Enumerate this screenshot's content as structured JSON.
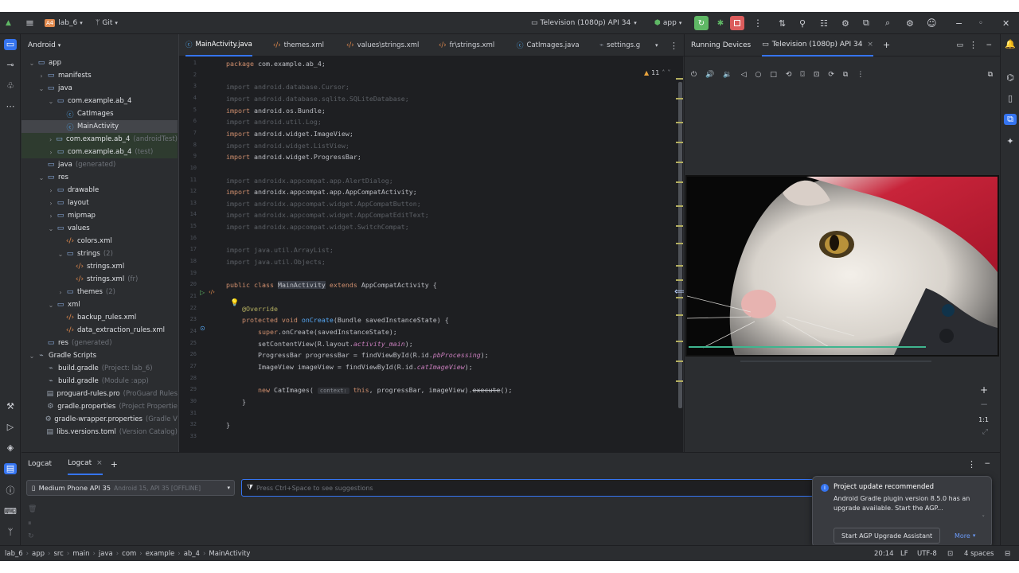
{
  "titlebar": {
    "project_badge": "A4",
    "project": "lab_6",
    "vcs": "Git",
    "device": "Television (1080p) API 34",
    "run_config": "app"
  },
  "project_panel": {
    "title": "Android",
    "tree": [
      {
        "label": "app",
        "sub": "",
        "depth": 0,
        "arrow": "v",
        "icon": "folder",
        "kind": "fold"
      },
      {
        "label": "manifests",
        "sub": "",
        "depth": 1,
        "arrow": ">",
        "icon": "folder",
        "kind": "fold"
      },
      {
        "label": "java",
        "sub": "",
        "depth": 1,
        "arrow": "v",
        "icon": "folder",
        "kind": "fold"
      },
      {
        "label": "com.example.ab_4",
        "sub": "",
        "depth": 2,
        "arrow": "v",
        "icon": "folder",
        "kind": "fold"
      },
      {
        "label": "CatImages",
        "sub": "",
        "depth": 3,
        "arrow": "",
        "icon": "class",
        "kind": "cls"
      },
      {
        "label": "MainActivity",
        "sub": "",
        "depth": 3,
        "arrow": "",
        "icon": "class",
        "kind": "cls",
        "selected": true
      },
      {
        "label": "com.example.ab_4",
        "sub": "(androidTest)",
        "depth": 2,
        "arrow": ">",
        "icon": "folder",
        "kind": "fold",
        "green": true
      },
      {
        "label": "com.example.ab_4",
        "sub": "(test)",
        "depth": 2,
        "arrow": ">",
        "icon": "folder",
        "kind": "fold",
        "green": true
      },
      {
        "label": "java",
        "sub": "(generated)",
        "depth": 1,
        "arrow": "",
        "icon": "folder",
        "kind": "fold"
      },
      {
        "label": "res",
        "sub": "",
        "depth": 1,
        "arrow": "v",
        "icon": "folder",
        "kind": "fold"
      },
      {
        "label": "drawable",
        "sub": "",
        "depth": 2,
        "arrow": ">",
        "icon": "folder",
        "kind": "fold"
      },
      {
        "label": "layout",
        "sub": "",
        "depth": 2,
        "arrow": ">",
        "icon": "folder",
        "kind": "fold"
      },
      {
        "label": "mipmap",
        "sub": "",
        "depth": 2,
        "arrow": ">",
        "icon": "folder",
        "kind": "fold"
      },
      {
        "label": "values",
        "sub": "",
        "depth": 2,
        "arrow": "v",
        "icon": "folder",
        "kind": "fold"
      },
      {
        "label": "colors.xml",
        "sub": "",
        "depth": 3,
        "arrow": "",
        "icon": "xml",
        "kind": "xmlc"
      },
      {
        "label": "strings",
        "sub": "(2)",
        "depth": 3,
        "arrow": "v",
        "icon": "folder",
        "kind": "fold"
      },
      {
        "label": "strings.xml",
        "sub": "",
        "depth": 4,
        "arrow": "",
        "icon": "xml",
        "kind": "xmlc"
      },
      {
        "label": "strings.xml",
        "sub": "(fr)",
        "depth": 4,
        "arrow": "",
        "icon": "xml",
        "kind": "xmlc"
      },
      {
        "label": "themes",
        "sub": "(2)",
        "depth": 3,
        "arrow": ">",
        "icon": "folder",
        "kind": "fold"
      },
      {
        "label": "xml",
        "sub": "",
        "depth": 2,
        "arrow": "v",
        "icon": "folder",
        "kind": "fold"
      },
      {
        "label": "backup_rules.xml",
        "sub": "",
        "depth": 3,
        "arrow": "",
        "icon": "xml",
        "kind": "xmlc"
      },
      {
        "label": "data_extraction_rules.xml",
        "sub": "",
        "depth": 3,
        "arrow": "",
        "icon": "xml",
        "kind": "xmlc"
      },
      {
        "label": "res",
        "sub": "(generated)",
        "depth": 1,
        "arrow": "",
        "icon": "folder",
        "kind": "fold"
      },
      {
        "label": "Gradle Scripts",
        "sub": "",
        "depth": 0,
        "arrow": "v",
        "icon": "gradle",
        "kind": "grd"
      },
      {
        "label": "build.gradle",
        "sub": "(Project: lab_6)",
        "depth": 1,
        "arrow": "",
        "icon": "gradle",
        "kind": "grd"
      },
      {
        "label": "build.gradle",
        "sub": "(Module :app)",
        "depth": 1,
        "arrow": "",
        "icon": "gradle",
        "kind": "grd"
      },
      {
        "label": "proguard-rules.pro",
        "sub": "(ProGuard Rules",
        "depth": 1,
        "arrow": "",
        "icon": "file",
        "kind": "grd"
      },
      {
        "label": "gradle.properties",
        "sub": "(Project Propertie",
        "depth": 1,
        "arrow": "",
        "icon": "gear",
        "kind": "grd"
      },
      {
        "label": "gradle-wrapper.properties",
        "sub": "(Gradle V",
        "depth": 1,
        "arrow": "",
        "icon": "gear",
        "kind": "grd"
      },
      {
        "label": "libs.versions.toml",
        "sub": "(Version Catalog)",
        "depth": 1,
        "arrow": "",
        "icon": "file",
        "kind": "grd"
      }
    ]
  },
  "editor": {
    "tabs": [
      "MainActivity.java",
      "themes.xml",
      "values\\strings.xml",
      "fr\\strings.xml",
      "CatImages.java",
      "settings.g"
    ],
    "warnings": "11",
    "code": [
      {
        "n": "1",
        "html": "<span class='kw'>package</span> <span class='pkg'>com.example.ab_4;</span>"
      },
      {
        "n": "2",
        "html": ""
      },
      {
        "n": "3",
        "html": "<span class='gr'>import android.database.Cursor;</span>"
      },
      {
        "n": "4",
        "html": "<span class='gr'>import android.database.sqlite.SQLiteDatabase;</span>"
      },
      {
        "n": "5",
        "html": "<span class='kw'>import</span> <span class='pkg'>android.os.Bundle;</span>"
      },
      {
        "n": "6",
        "html": "<span class='gr'>import android.util.Log;</span>"
      },
      {
        "n": "7",
        "html": "<span class='kw'>import</span> <span class='pkg'>android.widget.ImageView;</span>"
      },
      {
        "n": "8",
        "html": "<span class='gr'>import android.widget.ListView;</span>"
      },
      {
        "n": "9",
        "html": "<span class='kw'>import</span> <span class='pkg'>android.widget.ProgressBar;</span>"
      },
      {
        "n": "10",
        "html": ""
      },
      {
        "n": "11",
        "html": "<span class='gr'>import androidx.appcompat.app.AlertDialog;</span>"
      },
      {
        "n": "12",
        "html": "<span class='kw'>import</span> <span class='pkg'>androidx.appcompat.app.AppCompatActivity;</span>"
      },
      {
        "n": "13",
        "html": "<span class='gr'>import androidx.appcompat.widget.AppCompatButton;</span>"
      },
      {
        "n": "14",
        "html": "<span class='gr'>import androidx.appcompat.widget.AppCompatEditText;</span>"
      },
      {
        "n": "15",
        "html": "<span class='gr'>import androidx.appcompat.widget.SwitchCompat;</span>"
      },
      {
        "n": "16",
        "html": ""
      },
      {
        "n": "17",
        "html": "<span class='gr'>import java.util.ArrayList;</span>"
      },
      {
        "n": "18",
        "html": "<span class='gr'>import java.util.Objects;</span>"
      },
      {
        "n": "19",
        "html": ""
      },
      {
        "n": "20",
        "html": "<span class='kw'>public class</span> <span class='nm' style='background:#373b44'>MainActivity</span> <span class='kw'>extends</span> <span class='nm'>AppCompatActivity</span> <span class='nm'>{</span>"
      },
      {
        "n": "21",
        "html": ""
      },
      {
        "n": "22",
        "html": "    <span class='an'>@Override</span>"
      },
      {
        "n": "23",
        "html": "    <span class='kw'>protected void</span> <span class='fn'>onCreate</span><span class='nm'>(Bundle savedInstanceState) {</span>"
      },
      {
        "n": "24",
        "html": "        <span class='kw'>super</span><span class='nm'>.onCreate(savedInstanceState);</span>"
      },
      {
        "n": "25",
        "html": "        <span class='nm'>setContentView(R.layout.</span><span class='fd'>activity_main</span><span class='nm'>);</span>"
      },
      {
        "n": "26",
        "html": "        <span class='nm'>ProgressBar progressBar = findViewById(R.id.</span><span class='fd'>pbProcessing</span><span class='nm'>);</span>"
      },
      {
        "n": "27",
        "html": "        <span class='nm'>ImageView imageView = findViewById(R.id.</span><span class='fd'>catImageView</span><span class='nm'>);</span>"
      },
      {
        "n": "28",
        "html": ""
      },
      {
        "n": "29",
        "html": "        <span class='kw'>new</span> <span class='nm'>CatImages(</span> <span class='hint'>context:</span> <span class='kw'>this</span><span class='nm'>, progressBar, imageView).</span><span class='nm' style='text-decoration:line-through'>execute</span><span class='nm'>();</span>"
      },
      {
        "n": "30",
        "html": "    <span class='nm'>}</span>"
      },
      {
        "n": "31",
        "html": ""
      },
      {
        "n": "32",
        "html": "<span class='nm'>}</span>"
      },
      {
        "n": "33",
        "html": ""
      }
    ]
  },
  "running_devices": {
    "title": "Running Devices",
    "tab": "Television (1080p) API 34",
    "zoom_label": "1:1"
  },
  "bottom": {
    "tab1": "Logcat",
    "tab2": "Logcat",
    "device": "Medium Phone API 35",
    "device_sub": "Android 15, API 35 [OFFLINE]",
    "filter_placeholder": "Press Ctrl+Space to see suggestions"
  },
  "notification": {
    "title": "Project update recommended",
    "body": "Android Gradle plugin version 8.5.0 has an upgrade available. Start the AGP...",
    "button": "Start AGP Upgrade Assistant",
    "more": "More"
  },
  "statusbar": {
    "crumbs": [
      "lab_6",
      "app",
      "src",
      "main",
      "java",
      "com",
      "example",
      "ab_4",
      "MainActivity"
    ],
    "position": "20:14",
    "line_sep": "LF",
    "encoding": "UTF-8",
    "indent": "4 spaces"
  }
}
